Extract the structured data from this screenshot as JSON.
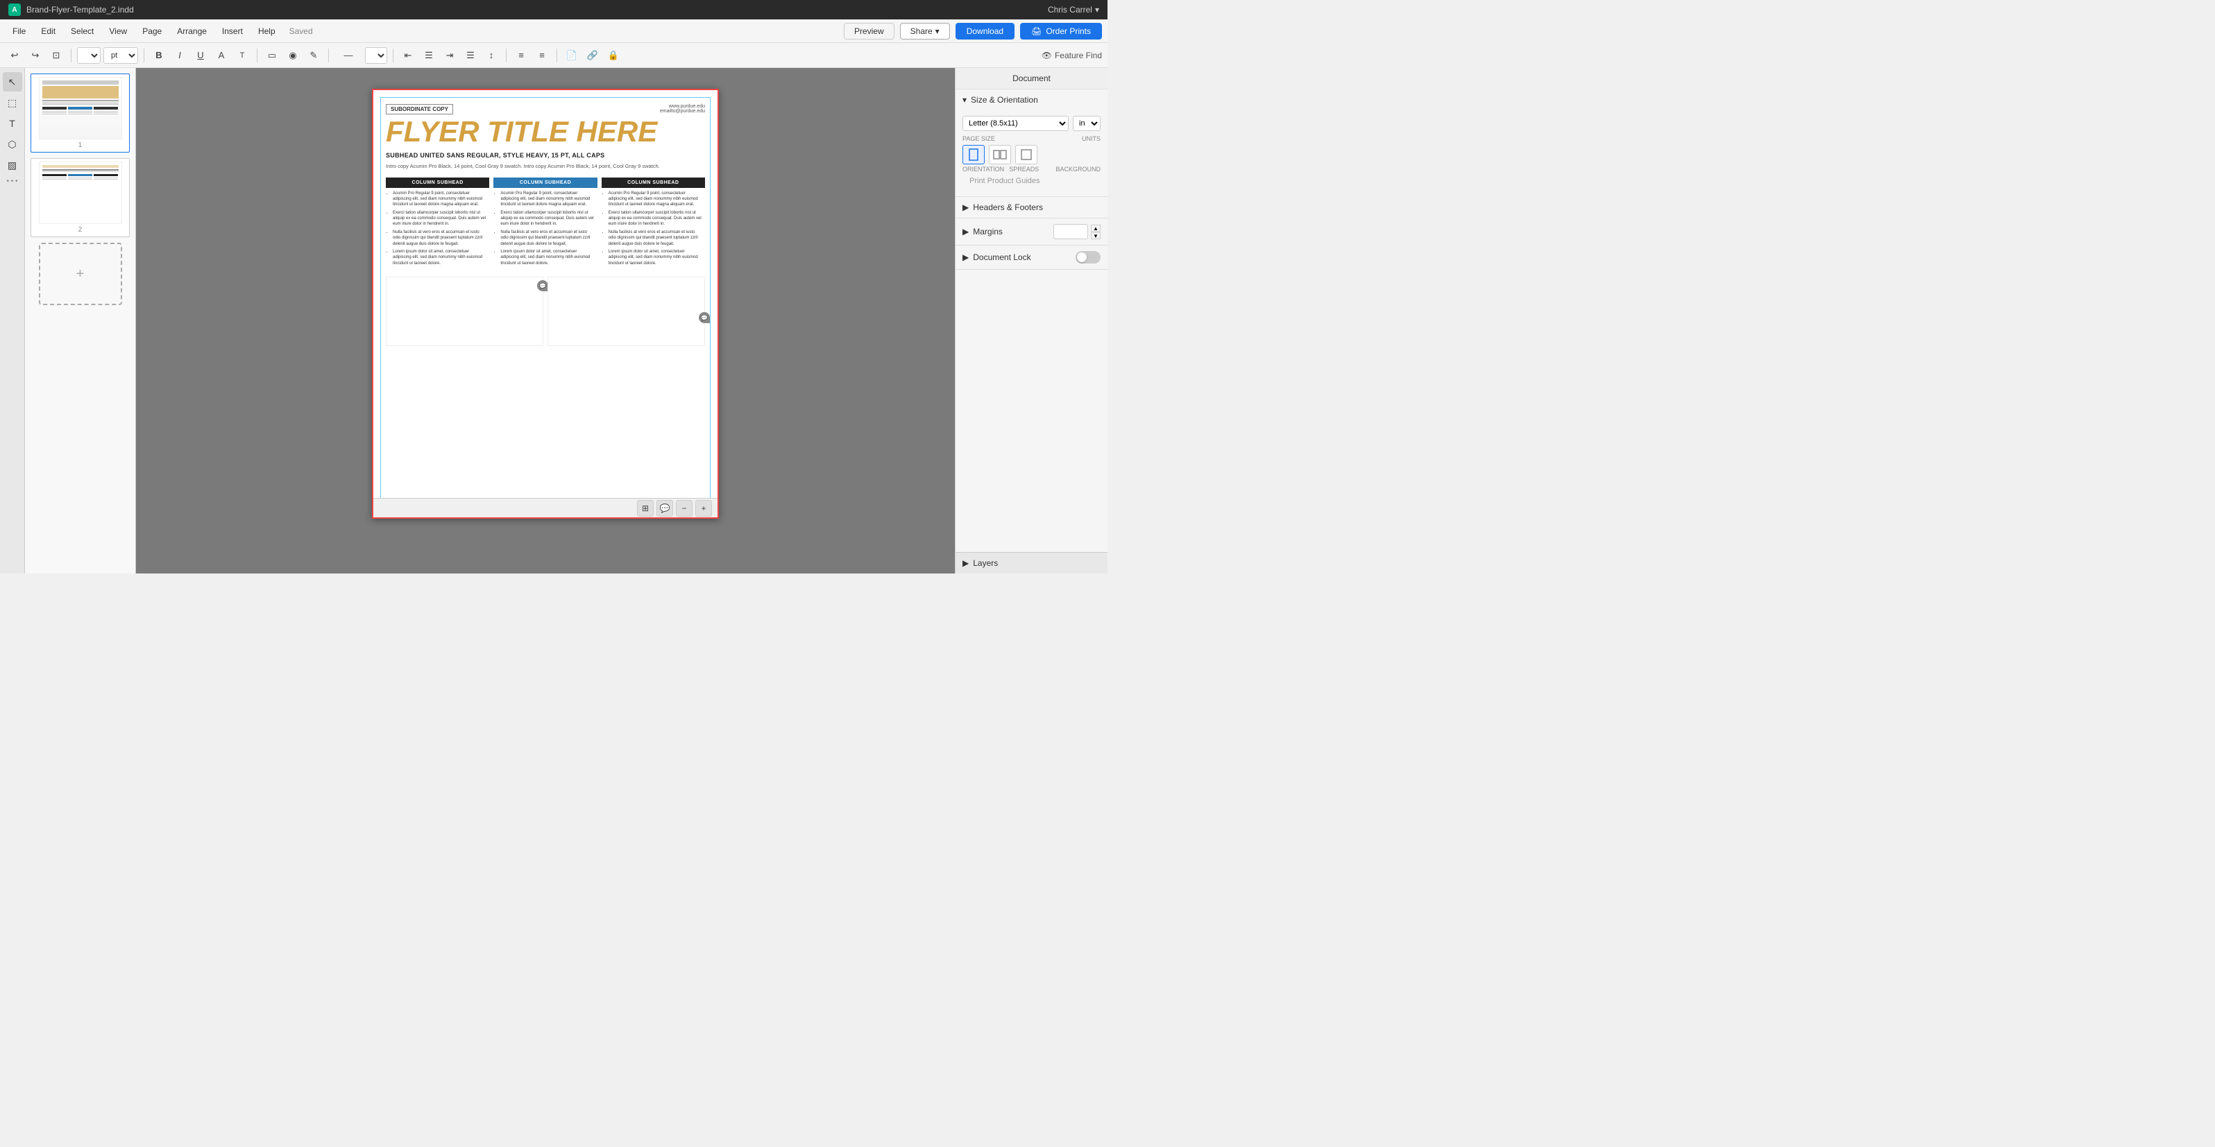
{
  "titleBar": {
    "appIcon": "A",
    "title": "Brand-Flyer-Template_2.indd",
    "user": "Chris Carrel",
    "chevron": "▾"
  },
  "menuBar": {
    "items": [
      "File",
      "Edit",
      "Select",
      "View",
      "Page",
      "Arrange",
      "Insert",
      "Help"
    ],
    "savedLabel": "Saved",
    "previewLabel": "Preview",
    "shareLabel": "Share",
    "downloadLabel": "Download",
    "orderLabel": "Order Prints"
  },
  "toolbar": {
    "undoIcon": "↩",
    "redoIcon": "↪",
    "copyStyleIcon": "⊡",
    "ptLabel": "pt",
    "boldIcon": "B",
    "italicIcon": "I",
    "underlineIcon": "U",
    "capsIcon": "A",
    "capsTIcon": "T",
    "frameIcon": "▭",
    "fillIcon": "◉",
    "penIcon": "✎",
    "lineIcon": "—",
    "alignLeftIcon": "≡",
    "alignCenterIcon": "≡",
    "alignRightIcon": "≡",
    "alignJustifyIcon": "≡",
    "listBulletIcon": "≡",
    "listNumIcon": "≡",
    "linkIcon": "🔗",
    "lockIcon": "🔒",
    "featureFind": "Feature Find"
  },
  "leftSidebar": {
    "tools": [
      "↖",
      "⬚",
      "T",
      "⬡",
      "▨",
      "⋮⋮"
    ]
  },
  "pages": [
    {
      "num": "1",
      "type": "first"
    },
    {
      "num": "2",
      "type": "second"
    },
    {
      "num": "add",
      "type": "add"
    }
  ],
  "document": {
    "subordinateCopy": "SUBORDINATE COPY",
    "contactLine1": "www.purdue.edu",
    "contactLine2": "emailto@purdue.edu",
    "flyerTitle": "FLYER TITLE HERE",
    "subhead": "SUBHEAD UNITED SANS REGULAR, STYLE HEAVY, 15 PT, ALL CAPS",
    "introCopy": "Intro copy Acumin Pro Black, 14 point, Cool Gray 9 swatch. Intro copy Acumin Pro Black, 14 point, Cool Gray 9 swatch.",
    "columns": [
      {
        "headStyle": "dark",
        "subhead": "COLUMN SUBHEAD",
        "bullets": [
          "Acumin Pro Regular 9 point, consectetuer adipiscing elit, sed diam nonummy nibh euismod tincidunt ut laoreet dolore magna aliquam erat.",
          "Exerci tation ullamcorper suscipit lobortis nisl ut aliquip ex ea commodo consequat. Duis autem vel eum iriure dolor in hendrerit in.",
          "Nulla facilisis at vero eros et accumsan et iusto odio dignissim qui blandit praesent luptatum zzril delenit augue duis dolore te feugait.",
          "Lorem ipsum dolor sit amet, consectetuer adipiscing elit, sed diam nonummy nibh euismod tincidunt ut laoreet dolore."
        ]
      },
      {
        "headStyle": "blue",
        "subhead": "COLUMN SUBHEAD",
        "bullets": [
          "Acumin Pro Regular 9 point, consectetuer adipiscing elit, sed diam nonummy nibh euismod tincidunt ut laoreet dolore magna aliquam erat.",
          "Exerci tation ullamcorper suscipit lobortis nisl ut aliquip ex ea commodo consequat. Duis autem vel eum iriure dolor in hendrerit in.",
          "Nulla facilisis at vero eros et accumsan et iusto odio dignissim qui blandit praesent luptatum zzril delenit augue duis dolore te feugait.",
          "Lorem ipsum dolor sit amet, consectetuer adipiscing elit, sed diam nonummy nibh euismod tincidunt ut laoreet dolore."
        ]
      },
      {
        "headStyle": "dark",
        "subhead": "COLUMN SUBHEAD",
        "bullets": [
          "Acumin Pro Regular 9 point, consectetuer adipiscing elit, sed diam nonummy nibh euismod tincidunt ut laoreet dolore magna aliquam erat.",
          "Exerci tation ullamcorper suscipit lobortis nisl ut aliquip ex ea commodo consequat. Duis autem vel eum iriure dolor in hendrerit in.",
          "Nulla facilisis at vero eros et accumsan et iusto odio dignissim qui blandit praesent luptatum zzril delenit augue duis dolore te feugait.",
          "Lorem ipsum dolor sit amet, consectetuer adipiscing elit, sed diam nonummy nibh euismod tincidunt ut laoreet dolore."
        ]
      }
    ]
  },
  "rightPanel": {
    "title": "Document",
    "sections": {
      "sizeOrientation": {
        "label": "Size & Orientation",
        "pageSizeLabel": "PAGE SIZE",
        "pageSizeValue": "Letter (8.5x11)",
        "unitsLabel": "UNITS",
        "unitsValue": "in",
        "orientationLabel": "ORIENTATION",
        "spreadsLabel": "SPREADS",
        "backgroundLabel": "BACKGROUND",
        "printGuides": "Print Product Guides"
      },
      "headersFooters": {
        "label": "Headers & Footers"
      },
      "margins": {
        "label": "Margins",
        "value": ""
      },
      "documentLock": {
        "label": "Document Lock",
        "toggleState": "off"
      }
    },
    "layers": {
      "label": "Layers"
    }
  },
  "bottomBar": {
    "gridIcon": "⊞",
    "commentIcon": "💬",
    "minusIcon": "−",
    "plusIcon": "+"
  }
}
